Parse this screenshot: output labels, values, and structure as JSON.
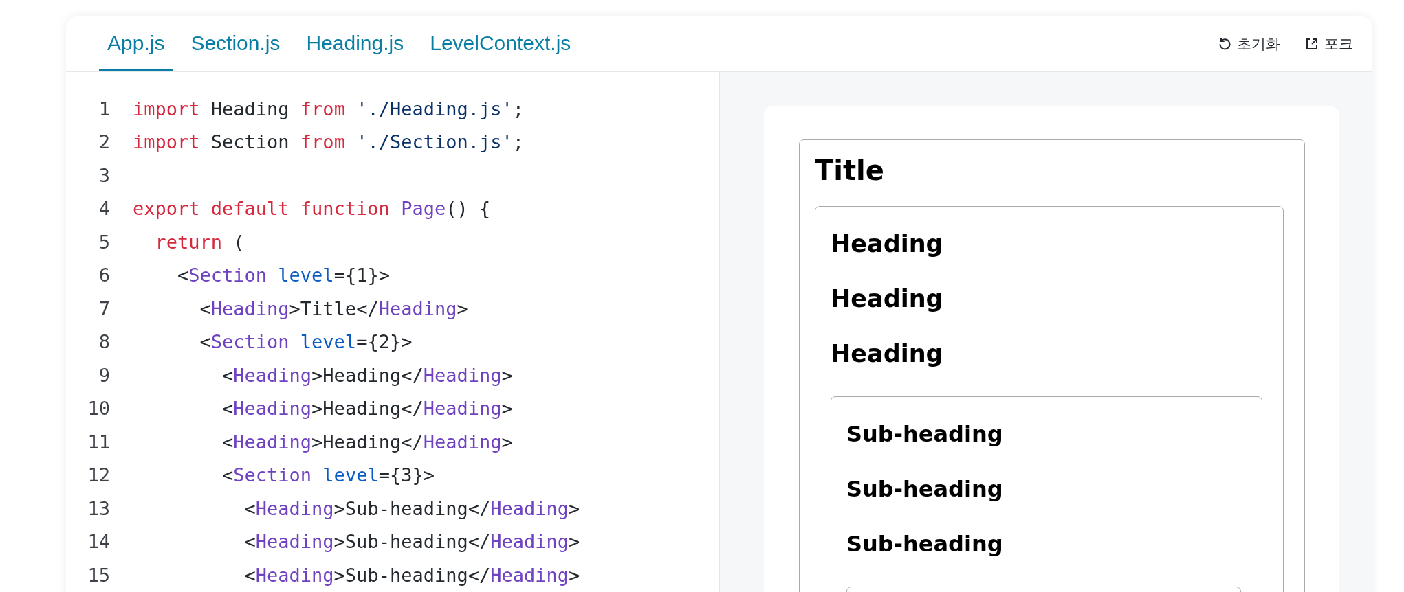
{
  "tabs": [
    {
      "label": "App.js",
      "selected": true
    },
    {
      "label": "Section.js",
      "selected": false
    },
    {
      "label": "Heading.js",
      "selected": false
    },
    {
      "label": "LevelContext.js",
      "selected": false
    }
  ],
  "actions": [
    {
      "label": "초기화",
      "kind": "reset"
    },
    {
      "label": "포크",
      "kind": "fork"
    }
  ],
  "code": [
    {
      "number": "1",
      "tokens": [
        {
          "text": "import",
          "kind": "keyword"
        },
        {
          "text": " Heading ",
          "kind": "plain"
        },
        {
          "text": "from",
          "kind": "keyword"
        },
        {
          "text": " './Heading.js'",
          "kind": "string"
        },
        {
          "text": ";",
          "kind": "plain"
        }
      ]
    },
    {
      "number": "2",
      "tokens": [
        {
          "text": "import",
          "kind": "keyword"
        },
        {
          "text": " Section ",
          "kind": "plain"
        },
        {
          "text": "from",
          "kind": "keyword"
        },
        {
          "text": " './Section.js'",
          "kind": "string"
        },
        {
          "text": ";",
          "kind": "plain"
        }
      ]
    },
    {
      "number": "3"
    },
    {
      "number": "4",
      "tokens": [
        {
          "text": "export default function",
          "kind": "keyword"
        },
        {
          "text": " Page",
          "kind": "tag"
        },
        {
          "text": "() {",
          "kind": "plain"
        }
      ]
    },
    {
      "number": "5",
      "tokens": [
        {
          "text": "  return",
          "kind": "keyword"
        },
        {
          "text": " (",
          "kind": "plain"
        }
      ]
    },
    {
      "number": "6",
      "tokens": [
        {
          "text": "    <",
          "kind": "plain"
        },
        {
          "text": "Section",
          "kind": "tag"
        },
        {
          "text": " level",
          "kind": "attr"
        },
        {
          "text": "={1}>",
          "kind": "plain"
        }
      ]
    },
    {
      "number": "7",
      "tokens": [
        {
          "text": "      <",
          "kind": "plain"
        },
        {
          "text": "Heading",
          "kind": "tag"
        },
        {
          "text": ">Title</",
          "kind": "plain"
        },
        {
          "text": "Heading",
          "kind": "tag"
        },
        {
          "text": ">",
          "kind": "plain"
        }
      ]
    },
    {
      "number": "8",
      "tokens": [
        {
          "text": "      <",
          "kind": "plain"
        },
        {
          "text": "Section",
          "kind": "tag"
        },
        {
          "text": " level",
          "kind": "attr"
        },
        {
          "text": "={2}>",
          "kind": "plain"
        }
      ]
    },
    {
      "number": "9",
      "tokens": [
        {
          "text": "        <",
          "kind": "plain"
        },
        {
          "text": "Heading",
          "kind": "tag"
        },
        {
          "text": ">Heading</",
          "kind": "plain"
        },
        {
          "text": "Heading",
          "kind": "tag"
        },
        {
          "text": ">",
          "kind": "plain"
        }
      ]
    },
    {
      "number": "10",
      "tokens": [
        {
          "text": "        <",
          "kind": "plain"
        },
        {
          "text": "Heading",
          "kind": "tag"
        },
        {
          "text": ">Heading</",
          "kind": "plain"
        },
        {
          "text": "Heading",
          "kind": "tag"
        },
        {
          "text": ">",
          "kind": "plain"
        }
      ]
    },
    {
      "number": "11",
      "tokens": [
        {
          "text": "        <",
          "kind": "plain"
        },
        {
          "text": "Heading",
          "kind": "tag"
        },
        {
          "text": ">Heading</",
          "kind": "plain"
        },
        {
          "text": "Heading",
          "kind": "tag"
        },
        {
          "text": ">",
          "kind": "plain"
        }
      ]
    },
    {
      "number": "12",
      "tokens": [
        {
          "text": "        <",
          "kind": "plain"
        },
        {
          "text": "Section",
          "kind": "tag"
        },
        {
          "text": " level",
          "kind": "attr"
        },
        {
          "text": "={3}>",
          "kind": "plain"
        }
      ]
    },
    {
      "number": "13",
      "tokens": [
        {
          "text": "          <",
          "kind": "plain"
        },
        {
          "text": "Heading",
          "kind": "tag"
        },
        {
          "text": ">Sub-heading</",
          "kind": "plain"
        },
        {
          "text": "Heading",
          "kind": "tag"
        },
        {
          "text": ">",
          "kind": "plain"
        }
      ]
    },
    {
      "number": "14",
      "tokens": [
        {
          "text": "          <",
          "kind": "plain"
        },
        {
          "text": "Heading",
          "kind": "tag"
        },
        {
          "text": ">Sub-heading</",
          "kind": "plain"
        },
        {
          "text": "Heading",
          "kind": "tag"
        },
        {
          "text": ">",
          "kind": "plain"
        }
      ]
    },
    {
      "number": "15",
      "tokens": [
        {
          "text": "          <",
          "kind": "plain"
        },
        {
          "text": "Heading",
          "kind": "tag"
        },
        {
          "text": ">Sub-heading</",
          "kind": "plain"
        },
        {
          "text": "Heading",
          "kind": "tag"
        },
        {
          "text": ">",
          "kind": "plain"
        }
      ]
    }
  ],
  "preview": {
    "sections": [
      {
        "kind": "section",
        "headings": [
          "Title"
        ],
        "children": [
          {
            "kind": "section",
            "headings": [
              "Heading",
              "Heading",
              "Heading"
            ],
            "children": [
              {
                "kind": "section",
                "headings": [
                  "Sub-heading",
                  "Sub-heading",
                  "Sub-heading"
                ],
                "children": [
                  {
                    "kind": "section"
                  }
                ]
              }
            ]
          }
        ]
      }
    ]
  }
}
